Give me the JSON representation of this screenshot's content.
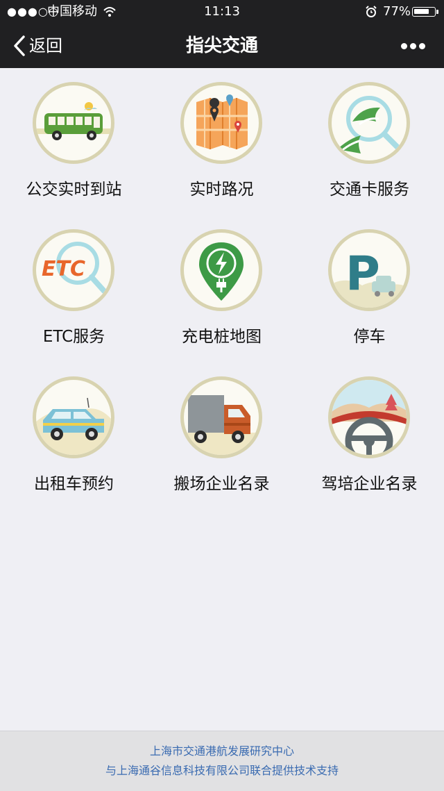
{
  "status_bar": {
    "signal": "●●●○○",
    "carrier": "中国移动",
    "time": "11:13",
    "battery_percent": "77%",
    "battery_level": 0.77
  },
  "nav": {
    "back_label": "返回",
    "title": "指尖交通"
  },
  "services": [
    {
      "label": "公交实时到站",
      "icon": "bus-icon"
    },
    {
      "label": "实时路况",
      "icon": "map-icon"
    },
    {
      "label": "交通卡服务",
      "icon": "transport-card-icon"
    },
    {
      "label": "ETC服务",
      "icon": "etc-icon",
      "icon_text": "ETC"
    },
    {
      "label": "充电桩地图",
      "icon": "charging-pin-icon"
    },
    {
      "label": "停车",
      "icon": "parking-icon",
      "icon_text": "P"
    },
    {
      "label": "出租车预约",
      "icon": "taxi-icon"
    },
    {
      "label": "搬场企业名录",
      "icon": "truck-icon"
    },
    {
      "label": "驾培企业名录",
      "icon": "steering-wheel-icon"
    }
  ],
  "footer": {
    "line1": "上海市交通港航发展研究中心",
    "line2": "与上海通谷信息科技有限公司联合提供技术支持"
  },
  "colors": {
    "topbar": "#202022",
    "background": "#efeff4",
    "icon_ring": "#d8d3b0",
    "footer_text": "#3a6bb1"
  }
}
